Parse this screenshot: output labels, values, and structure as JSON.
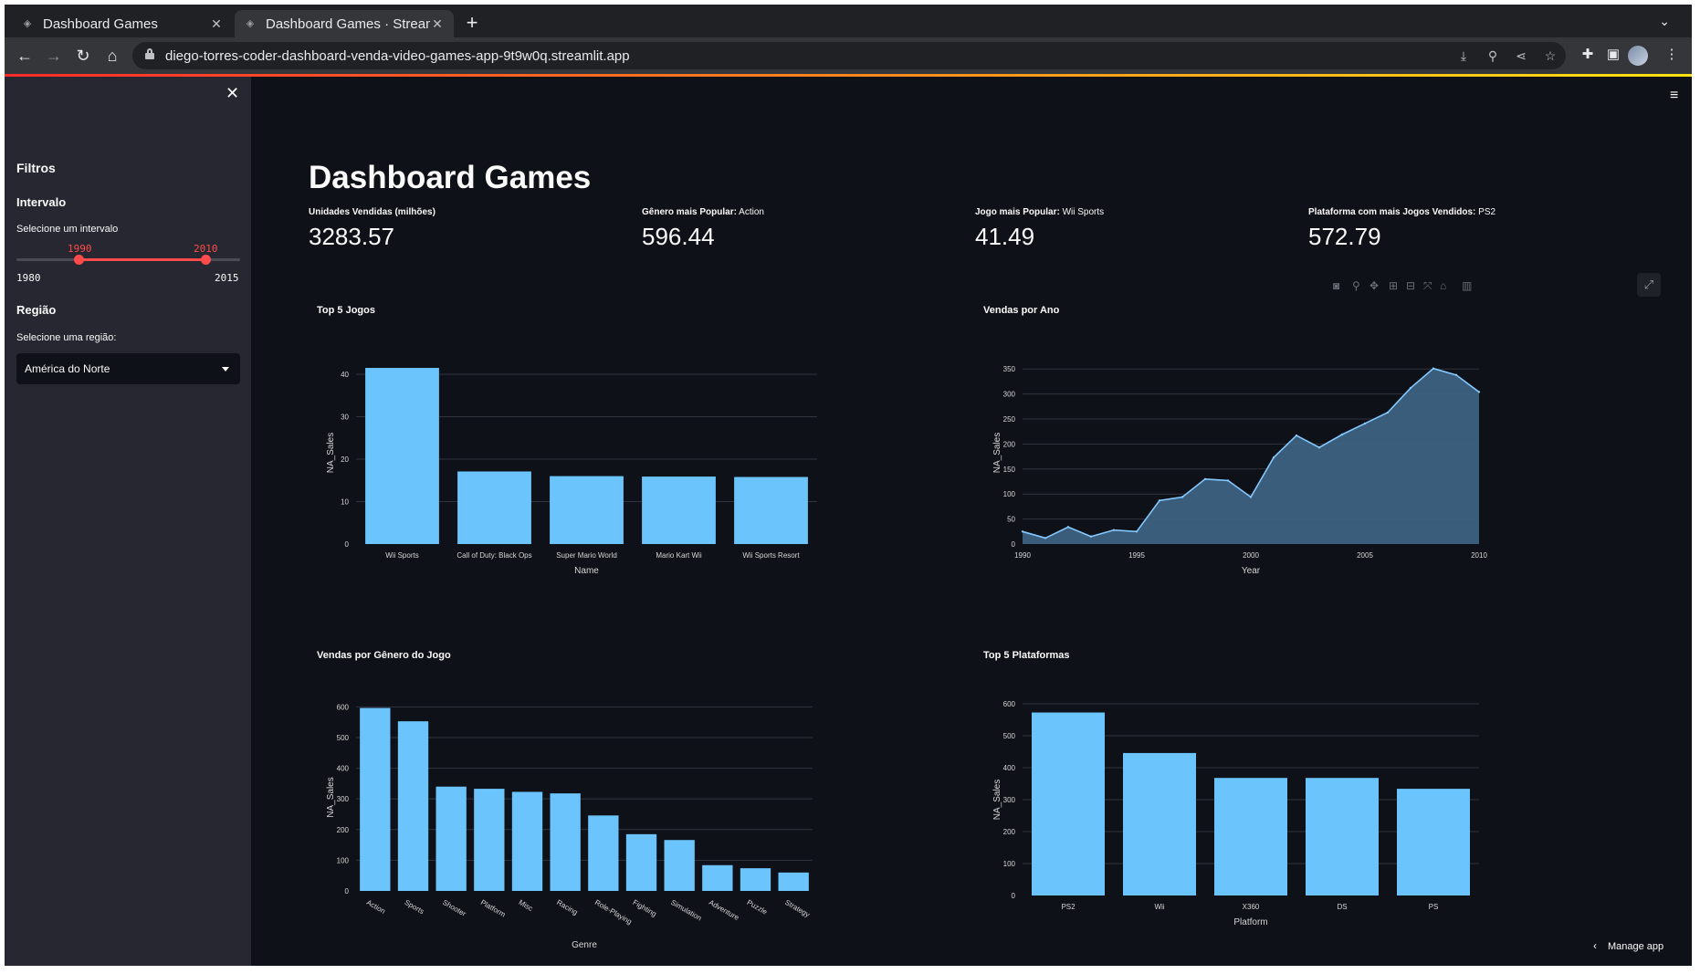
{
  "browser": {
    "tabs": [
      {
        "title": "Dashboard Games",
        "active": false
      },
      {
        "title": "Dashboard Games · Streamlit",
        "active": true
      }
    ],
    "url": "diego-torres-coder-dashboard-venda-video-games-app-9t9w0q.streamlit.app"
  },
  "sidebar": {
    "heading": "Filtros",
    "interval_heading": "Intervalo",
    "interval_label": "Selecione um intervalo",
    "slider": {
      "min": "1980",
      "max": "2015",
      "low": "1990",
      "high": "2010",
      "min_value": 1980,
      "max_value": 2015,
      "low_value": 1990,
      "high_value": 2010
    },
    "region_heading": "Região",
    "region_label": "Selecione uma região:",
    "region_value": "América do Norte"
  },
  "main": {
    "title": "Dashboard Games",
    "metrics": [
      {
        "label": "Unidades Vendidas (milhões)",
        "suffix": "",
        "value": "3283.57"
      },
      {
        "label": "Gênero mais Popular:",
        "suffix": "Action",
        "value": "596.44"
      },
      {
        "label": "Jogo mais Popular:",
        "suffix": "Wii Sports",
        "value": "41.49"
      },
      {
        "label": "Plataforma com mais Jogos Vendidos:",
        "suffix": "PS2",
        "value": "572.79"
      }
    ],
    "manage_app": "Manage app"
  },
  "colors": {
    "bar": "#6bc4fb",
    "area_fill": "#3d6282",
    "area_line": "#83c9ff",
    "accent": "#ff4b4b"
  },
  "chart_data": [
    {
      "type": "bar",
      "title": "Top 5 Jogos",
      "xlabel": "Name",
      "ylabel": "NA_Sales",
      "categories": [
        "Wii Sports",
        "Call of Duty: Black Ops",
        "Super Mario World",
        "Mario Kart Wii",
        "Wii Sports Resort"
      ],
      "values": [
        41.49,
        17.1,
        16.0,
        15.9,
        15.8
      ],
      "ylim": [
        0,
        43
      ],
      "yticks": [
        0,
        10,
        20,
        30,
        40
      ]
    },
    {
      "type": "area",
      "title": "Vendas por Ano",
      "xlabel": "Year",
      "ylabel": "NA_Sales",
      "x": [
        1990,
        1991,
        1992,
        1993,
        1994,
        1995,
        1996,
        1997,
        1998,
        1999,
        2000,
        2001,
        2002,
        2003,
        2004,
        2005,
        2006,
        2007,
        2008,
        2009,
        2010
      ],
      "values": [
        25,
        12,
        34,
        15,
        28,
        25,
        87,
        94,
        130,
        127,
        94,
        173,
        217,
        193,
        219,
        241,
        263,
        312,
        351,
        338,
        304
      ],
      "xlim": [
        1990,
        2010
      ],
      "ylim": [
        0,
        365
      ],
      "xticks": [
        1990,
        1995,
        2000,
        2005,
        2010
      ],
      "yticks": [
        0,
        50,
        100,
        150,
        200,
        250,
        300,
        350
      ]
    },
    {
      "type": "bar",
      "title": "Vendas por Gênero do Jogo",
      "xlabel": "Genre",
      "ylabel": "NA_Sales",
      "categories": [
        "Action",
        "Sports",
        "Shooter",
        "Platform",
        "Misc",
        "Racing",
        "Role-Playing",
        "Fighting",
        "Simulation",
        "Adventure",
        "Puzzle",
        "Strategy"
      ],
      "values": [
        596.44,
        553,
        340,
        333,
        323,
        318,
        246,
        185,
        166,
        84,
        74,
        60
      ],
      "ylim": [
        0,
        610
      ],
      "yticks": [
        0,
        100,
        200,
        300,
        400,
        500,
        600
      ]
    },
    {
      "type": "bar",
      "title": "Top 5 Plataformas",
      "xlabel": "Platform",
      "ylabel": "NA_Sales",
      "categories": [
        "PS2",
        "Wii",
        "X360",
        "DS",
        "PS"
      ],
      "values": [
        572.79,
        446,
        368,
        368,
        334
      ],
      "ylim": [
        0,
        600
      ],
      "yticks": [
        0,
        100,
        200,
        300,
        400,
        500,
        600
      ]
    }
  ]
}
